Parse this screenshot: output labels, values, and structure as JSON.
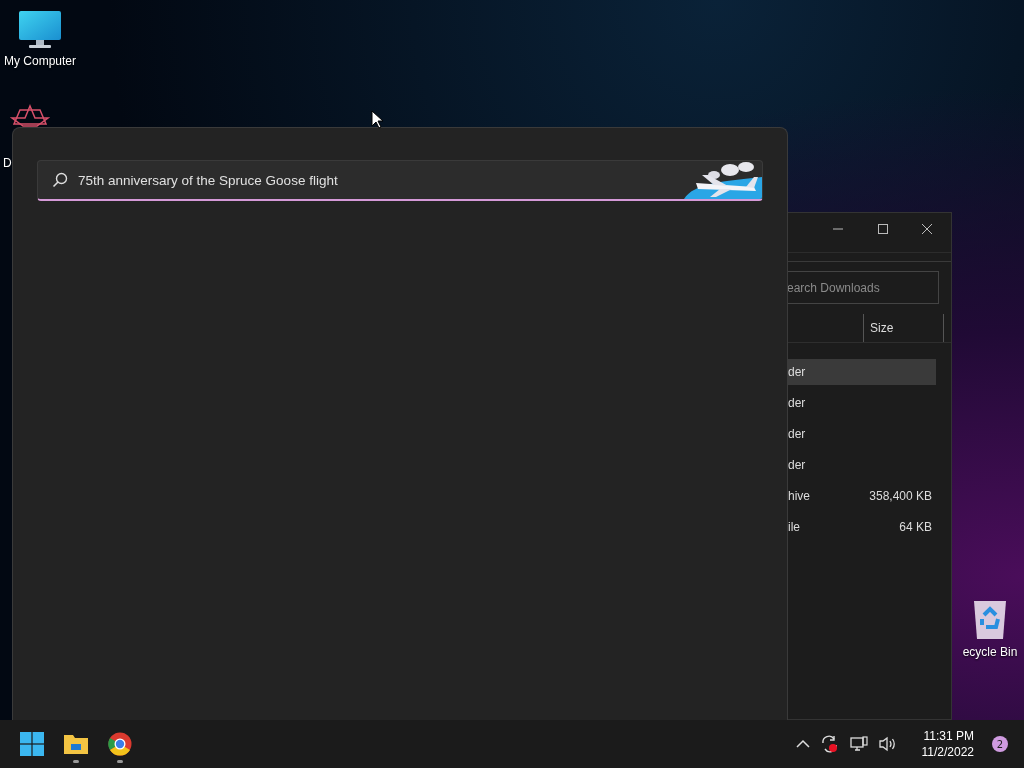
{
  "desktop_icons": [
    {
      "kind": "computer",
      "label": "My Computer"
    },
    {
      "kind": "app",
      "label": "D"
    },
    {
      "kind": "recycle",
      "label": "ecycle Bin"
    }
  ],
  "search_panel": {
    "query": "75th anniversary of the Spruce Goose flight"
  },
  "explorer": {
    "search": {
      "placeholder": "earch Downloads"
    },
    "columns": [
      "Size"
    ],
    "rows": [
      {
        "type": "der",
        "size": "",
        "selected": true
      },
      {
        "type": "der",
        "size": "",
        "selected": false
      },
      {
        "type": "der",
        "size": "",
        "selected": false
      },
      {
        "type": "der",
        "size": "",
        "selected": false
      },
      {
        "type": "hive",
        "size": "358,400 KB",
        "selected": false
      },
      {
        "type": "ile",
        "size": "64 KB",
        "selected": false
      }
    ]
  },
  "taskbar": {
    "apps": [
      {
        "kind": "start",
        "running": false
      },
      {
        "kind": "files",
        "running": true
      },
      {
        "kind": "browser",
        "running": true
      }
    ],
    "tray": [
      {
        "kind": "chevron"
      },
      {
        "kind": "sync"
      },
      {
        "kind": "network"
      },
      {
        "kind": "volume"
      }
    ],
    "time": "11:31 PM",
    "date": "11/2/2022",
    "notifications": "2"
  }
}
